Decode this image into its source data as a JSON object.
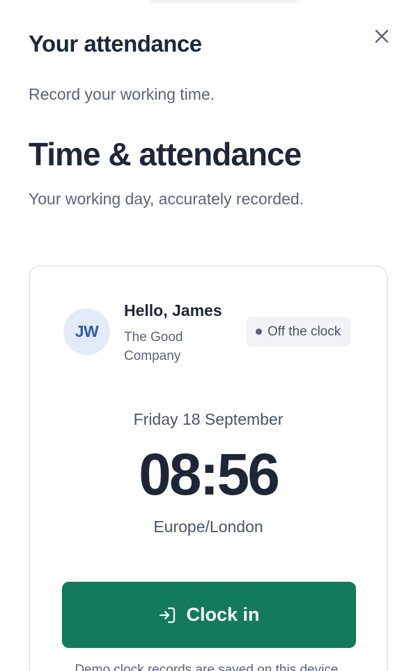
{
  "header": {
    "title": "Your attendance",
    "close_icon": "close-icon"
  },
  "intro": {
    "subtitle": "Record your working time."
  },
  "section": {
    "title": "Time & attendance",
    "subtitle": "Your working day, accurately recorded."
  },
  "card": {
    "avatar_initials": "JW",
    "greeting": "Hello, James",
    "company": "The Good Company",
    "status": "Off the clock",
    "date": "Friday 18 September",
    "time": "08:56",
    "timezone": "Europe/London",
    "clock_button_label": "Clock in",
    "clock_button_icon": "login-arrow-icon",
    "footnote": "Demo clock records are saved on this device."
  },
  "colors": {
    "primary_button": "#137a5c",
    "avatar_bg": "#e3ebf8",
    "avatar_text": "#2f5fa6",
    "text_primary": "#1e2738",
    "text_secondary": "#5b6476"
  }
}
